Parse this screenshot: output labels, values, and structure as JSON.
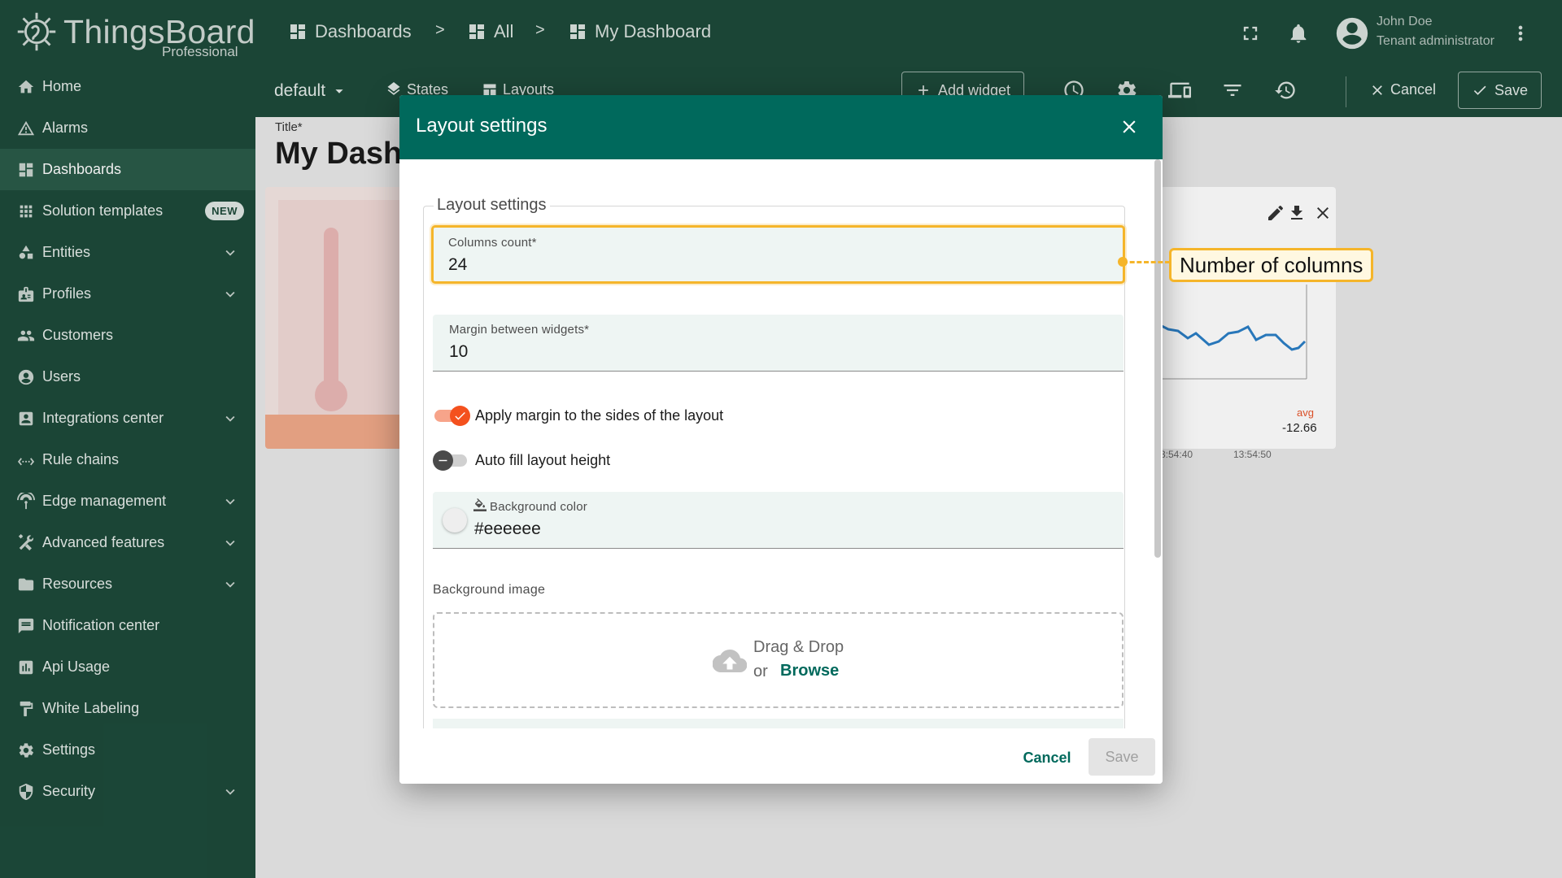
{
  "brand": {
    "name": "ThingsBoard",
    "edition": "Professional"
  },
  "sidebar": {
    "items": [
      {
        "label": "Home",
        "icon": "home-icon",
        "chevron": false
      },
      {
        "label": "Alarms",
        "icon": "alarm-icon",
        "chevron": false
      },
      {
        "label": "Dashboards",
        "icon": "dashboard-icon",
        "chevron": false,
        "active": true
      },
      {
        "label": "Solution templates",
        "icon": "apps-icon",
        "badge": "NEW"
      },
      {
        "label": "Entities",
        "icon": "entities-icon",
        "chevron": true
      },
      {
        "label": "Profiles",
        "icon": "profiles-icon",
        "chevron": true
      },
      {
        "label": "Customers",
        "icon": "customers-icon",
        "chevron": false
      },
      {
        "label": "Users",
        "icon": "users-icon",
        "chevron": false
      },
      {
        "label": "Integrations center",
        "icon": "integrations-icon",
        "chevron": true
      },
      {
        "label": "Rule chains",
        "icon": "rule-chains-icon",
        "chevron": false
      },
      {
        "label": "Edge management",
        "icon": "edge-icon",
        "chevron": true
      },
      {
        "label": "Advanced features",
        "icon": "tools-icon",
        "chevron": true
      },
      {
        "label": "Resources",
        "icon": "folder-icon",
        "chevron": true
      },
      {
        "label": "Notification center",
        "icon": "notification-icon",
        "chevron": false
      },
      {
        "label": "Api Usage",
        "icon": "api-usage-icon",
        "chevron": false
      },
      {
        "label": "White Labeling",
        "icon": "paint-roller-icon",
        "chevron": false
      },
      {
        "label": "Settings",
        "icon": "settings-icon",
        "chevron": false
      },
      {
        "label": "Security",
        "icon": "security-icon",
        "chevron": true
      }
    ]
  },
  "breadcrumbs": {
    "dashboards": "Dashboards",
    "all": "All",
    "current": "My Dashboard",
    "sep": ">"
  },
  "user": {
    "name": "John Doe",
    "role": "Tenant administrator"
  },
  "toolbar": {
    "state": "default",
    "states": "States",
    "layouts": "Layouts",
    "add_widget": "Add widget",
    "cancel": "Cancel",
    "save": "Save"
  },
  "dashboard": {
    "title_label": "Title*",
    "title": "My Dash",
    "chart": {
      "ticks": [
        "3:54:40",
        "13:54:50"
      ],
      "avg_label": "avg",
      "avg_value": "-12.66"
    }
  },
  "dialog": {
    "title": "Layout settings",
    "legend": "Layout settings",
    "columns_count": {
      "label": "Columns count*",
      "value": "24"
    },
    "margin": {
      "label": "Margin between widgets*",
      "value": "10"
    },
    "apply_margin": {
      "label": "Apply margin to the sides of the layout",
      "checked": true
    },
    "auto_fill": {
      "label": "Auto fill layout height",
      "checked": false
    },
    "background_color": {
      "label": "Background color",
      "value": "#eeeeee"
    },
    "background_image_label": "Background image",
    "dropzone": {
      "text": "Drag & Drop",
      "or": "or",
      "browse": "Browse"
    },
    "cancel": "Cancel",
    "save": "Save"
  },
  "annotation": {
    "text": "Number of columns"
  },
  "colors": {
    "primary": "#00695c",
    "sidebar": "#1d4a3a",
    "toggle_on": "#f4511e",
    "highlight": "#f5b52a"
  }
}
